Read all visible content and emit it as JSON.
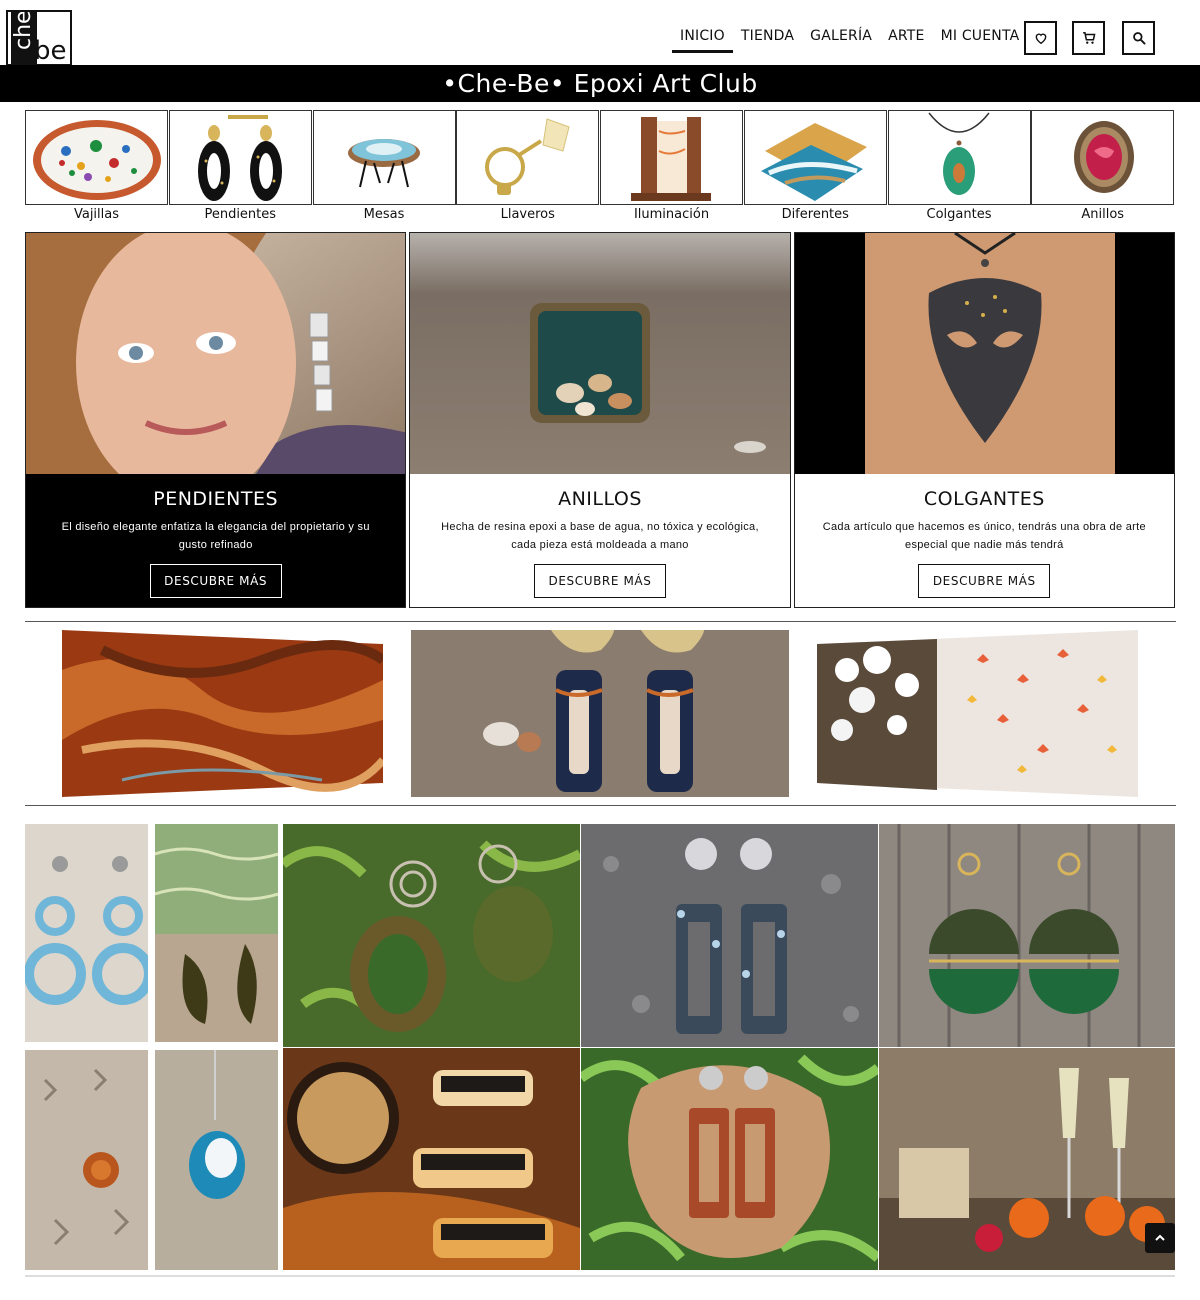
{
  "brand": {
    "logo_top": "che",
    "logo_bottom": "be",
    "site_title": "•Che-Be• Epoxi Art Club"
  },
  "nav": {
    "items": [
      {
        "label": "INICIO",
        "active": true
      },
      {
        "label": "TIENDA",
        "active": false
      },
      {
        "label": "GALERÍA",
        "active": false
      },
      {
        "label": "ARTE",
        "active": false
      },
      {
        "label": "MI CUENTA",
        "active": false
      }
    ],
    "icons": [
      "heart-icon",
      "cart-icon",
      "search-icon"
    ]
  },
  "categories": [
    {
      "label": "Vajillas"
    },
    {
      "label": "Pendientes"
    },
    {
      "label": "Mesas"
    },
    {
      "label": "Llaveros"
    },
    {
      "label": "Iluminación"
    },
    {
      "label": "Diferentes"
    },
    {
      "label": "Colgantes"
    },
    {
      "label": "Anillos"
    }
  ],
  "features": [
    {
      "title": "PENDIENTES",
      "text": "El diseño elegante enfatiza la elegancia del propietario y su gusto refinado",
      "cta": "DESCUBRE MÁS"
    },
    {
      "title": "ANILLOS",
      "text": "Hecha de resina epoxi a base de agua, no tóxica y ecológica, cada pieza está moldeada a mano",
      "cta": "DESCUBRE MÁS"
    },
    {
      "title": "COLGANTES",
      "text": "Cada artículo que hacemos es único, tendrás una obra de arte especial que nadie más tendrá",
      "cta": "DESCUBRE MÁS"
    }
  ],
  "colors": {
    "black": "#000000",
    "white": "#ffffff",
    "border": "#222222"
  }
}
